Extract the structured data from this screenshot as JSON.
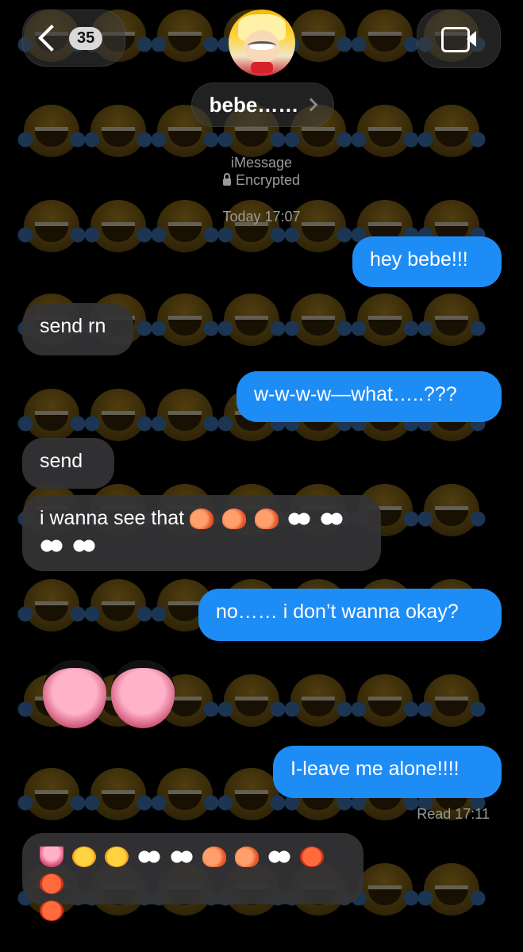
{
  "header": {
    "unread_count": "35",
    "contact_name": "bebe……"
  },
  "meta": {
    "service": "iMessage",
    "encryption": "Encrypted",
    "timestamp": "Today 17:07"
  },
  "messages": [
    {
      "from": "me",
      "text": "hey bebe!!!"
    },
    {
      "from": "them",
      "text": "send rn"
    },
    {
      "from": "me",
      "text": "w-w-w-w—what…..???"
    },
    {
      "from": "them",
      "text": "send"
    },
    {
      "from": "them",
      "text": "i wanna see that"
    },
    {
      "from": "me",
      "text": "no…… i don’t wanna okay?"
    },
    {
      "from": "them",
      "text": ""
    },
    {
      "from": "me",
      "text": "I-leave me alone!!!!"
    },
    {
      "from": "them",
      "text": ""
    }
  ],
  "read_receipt": "Read 17:11",
  "colors": {
    "sent_bubble": "#1e8cf5",
    "received_bubble": "#343436",
    "background": "#000000"
  },
  "icons": {
    "back": "chevron-left-icon",
    "video": "video-camera-icon",
    "lock": "lock-icon"
  }
}
